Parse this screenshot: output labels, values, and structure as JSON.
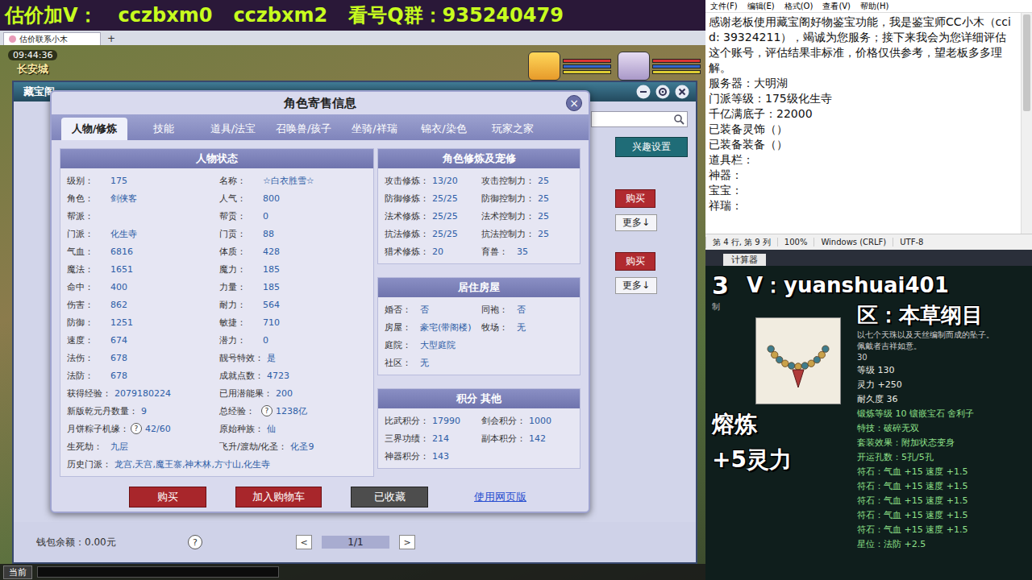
{
  "banner": {
    "items": [
      "估价加V：",
      "cczbxm0",
      "cczbxm2",
      "看号Q群：935240479"
    ]
  },
  "browser_tab": {
    "title": "估价联系小木",
    "new_tab": "+"
  },
  "hud": {
    "time": "09:44:36",
    "location": "长安城"
  },
  "market_window": {
    "title": "藏宝阁",
    "interest_button": "兴趣设置",
    "listings": [
      {
        "buy": "购买",
        "more": "更多↓"
      },
      {
        "buy": "购买",
        "more": "更多↓"
      }
    ],
    "wallet": "钱包余额：0.00元",
    "help": "?",
    "pager": {
      "prev": "<",
      "page": "1/1",
      "next": ">"
    }
  },
  "dialog": {
    "title": "角色寄售信息",
    "close": "×",
    "tabs": [
      {
        "label": "人物/修炼",
        "selected": true
      },
      {
        "label": "技能",
        "selected": false
      },
      {
        "label": "道具/法宝",
        "selected": false
      },
      {
        "label": "召唤兽/孩子",
        "selected": false
      },
      {
        "label": "坐骑/祥瑞",
        "selected": false
      },
      {
        "label": "锦衣/染色",
        "selected": false
      },
      {
        "label": "玩家之家",
        "selected": false
      }
    ],
    "status": {
      "title": "人物状态",
      "rows": [
        [
          {
            "label": "级别：",
            "value": "175"
          },
          {
            "label": "名称：",
            "value": "☆白衣胜雪☆"
          }
        ],
        [
          {
            "label": "角色：",
            "value": "剑侠客"
          },
          {
            "label": "人气：",
            "value": "800"
          }
        ],
        [
          {
            "label": "帮派：",
            "value": ""
          },
          {
            "label": "帮贡：",
            "value": "0"
          }
        ],
        [
          {
            "label": "门派：",
            "value": "化生寺"
          },
          {
            "label": "门贡：",
            "value": "88"
          }
        ],
        [
          {
            "label": "气血：",
            "value": "6816"
          },
          {
            "label": "体质：",
            "value": "428"
          }
        ],
        [
          {
            "label": "魔法：",
            "value": "1651"
          },
          {
            "label": "魔力：",
            "value": "185"
          }
        ],
        [
          {
            "label": "命中：",
            "value": "400"
          },
          {
            "label": "力量：",
            "value": "185"
          }
        ],
        [
          {
            "label": "伤害：",
            "value": "862"
          },
          {
            "label": "耐力：",
            "value": "564"
          }
        ],
        [
          {
            "label": "防御：",
            "value": "1251"
          },
          {
            "label": "敏捷：",
            "value": "710"
          }
        ],
        [
          {
            "label": "速度：",
            "value": "674"
          },
          {
            "label": "潜力：",
            "value": "0"
          }
        ],
        [
          {
            "label": "法伤：",
            "value": "678"
          },
          {
            "label": "靓号特效：",
            "value": "是"
          }
        ],
        [
          {
            "label": "法防：",
            "value": "678"
          },
          {
            "label": "成就点数：",
            "value": "4723"
          }
        ],
        [
          {
            "label": "获得经验：",
            "value": "2079180224"
          },
          {
            "label": "已用潜能果：",
            "value": "200"
          }
        ],
        [
          {
            "label": "新版乾元丹数量：",
            "value": "9"
          },
          {
            "label": "总经验：",
            "help": "?",
            "value": "1238亿"
          }
        ],
        [
          {
            "label": "月饼粽子机缘：",
            "help": "?",
            "value": "42/60"
          },
          {
            "label": "原始种族：",
            "value": "仙"
          }
        ],
        [
          {
            "label": "生死劫：",
            "value": "九层"
          },
          {
            "label": "飞升/渡劫/化圣：",
            "value": "化圣9"
          }
        ]
      ],
      "history": {
        "label": "历史门派：",
        "value": "龙宫,天宫,魔王寨,神木林,方寸山,化生寺"
      }
    },
    "sections": [
      {
        "title": "角色修炼及宠修",
        "rows": [
          [
            {
              "label": "攻击修炼：",
              "value": "13/20"
            },
            {
              "label": "攻击控制力：",
              "value": "25"
            }
          ],
          [
            {
              "label": "防御修炼：",
              "value": "25/25"
            },
            {
              "label": "防御控制力：",
              "value": "25"
            }
          ],
          [
            {
              "label": "法术修炼：",
              "value": "25/25"
            },
            {
              "label": "法术控制力：",
              "value": "25"
            }
          ],
          [
            {
              "label": "抗法修炼：",
              "value": "25/25"
            },
            {
              "label": "抗法控制力：",
              "value": "25"
            }
          ],
          [
            {
              "label": "猎术修炼：",
              "value": "20"
            },
            {
              "label": "育兽：",
              "value": "35"
            }
          ]
        ]
      },
      {
        "title": "居住房屋",
        "rows": [
          [
            {
              "label": "婚否：",
              "value": "否"
            },
            {
              "label": "同袍：",
              "value": "否"
            }
          ],
          [
            {
              "label": "房屋：",
              "value": "豪宅(带阁楼)"
            },
            {
              "label": "牧场：",
              "value": "无"
            }
          ],
          [
            {
              "label": "庭院：",
              "value": "大型庭院"
            }
          ],
          [
            {
              "label": "社区：",
              "value": "无"
            }
          ]
        ]
      },
      {
        "title": "积分 其他",
        "rows": [
          [
            {
              "label": "比武积分：",
              "value": "17990"
            },
            {
              "label": "剑会积分：",
              "value": "1000"
            }
          ],
          [
            {
              "label": "三界功绩：",
              "value": "214"
            },
            {
              "label": "副本积分：",
              "value": "142"
            }
          ],
          [
            {
              "label": "神器积分：",
              "value": "143"
            }
          ]
        ]
      }
    ],
    "buttons": [
      {
        "label": "购买",
        "kind": "primary"
      },
      {
        "label": "加入购物车",
        "kind": "primary"
      },
      {
        "label": "已收藏",
        "kind": "muted"
      },
      {
        "label": "使用网页版",
        "kind": "link"
      }
    ]
  },
  "chat_bar": {
    "channel": "当前"
  },
  "notepad": {
    "menu": [
      "文件(F)",
      "编辑(E)",
      "格式(O)",
      "查看(V)",
      "帮助(H)"
    ],
    "lines": [
      "感谢老板使用藏宝阁好物鉴宝功能，我是鉴宝师CC小木（ccid: 39324211），竭诚为您服务；接下来我会为您详细评估这个账号，评估结果非标准，价格仅供参考，望老板多多理解。",
      "服务器：大明湖",
      "门派等级：175级化生寺",
      "千亿满底子：22000",
      "已装备灵饰（）",
      "已装备装备（）",
      "道具栏：",
      "神器：",
      "宝宝：",
      "祥瑞："
    ],
    "status": [
      "第 4 行, 第 9 列",
      "100%",
      "Windows (CRLF)",
      "UTF-8"
    ]
  },
  "taskbar_strip": {
    "label": "计算器"
  },
  "item_panel": {
    "overlay_number": "3",
    "contact": "V：yuanshuai401",
    "server": "区：本草纲目",
    "edge_text": "制",
    "description": [
      "以七个天珠以及天丝编制而成的坠子。",
      "佩戴者吉祥如意。"
    ],
    "requirement": "30",
    "stats": [
      {
        "text": "等级 130",
        "color": "#ecece4"
      },
      {
        "text": "灵力 +250",
        "color": "#ecece4"
      },
      {
        "text": "耐久度 36",
        "color": "#ecece4"
      },
      {
        "text": "锻炼等级 10 镶嵌宝石 舍利子",
        "color": "#8ee08a"
      },
      {
        "text": "特技：破碎无双",
        "color": "#8ee08a"
      },
      {
        "text": "套装效果：附加状态变身",
        "color": "#8ee08a"
      },
      {
        "text": "开运孔数：5孔/5孔",
        "color": "#8ee08a"
      },
      {
        "text": "符石：气血 +15 速度 +1.5",
        "color": "#8ee08a"
      },
      {
        "text": "符石：气血 +15 速度 +1.5",
        "color": "#8ee08a"
      },
      {
        "text": "符石：气血 +15 速度 +1.5",
        "color": "#8ee08a"
      },
      {
        "text": "符石：气血 +15 速度 +1.5",
        "color": "#8ee08a"
      },
      {
        "text": "符石：气血 +15 速度 +1.5",
        "color": "#8ee08a"
      },
      {
        "text": "星位：法防 +2.5",
        "color": "#8ee08a"
      }
    ],
    "smelt": "熔炼",
    "smelt_bonus": "+5灵力"
  }
}
